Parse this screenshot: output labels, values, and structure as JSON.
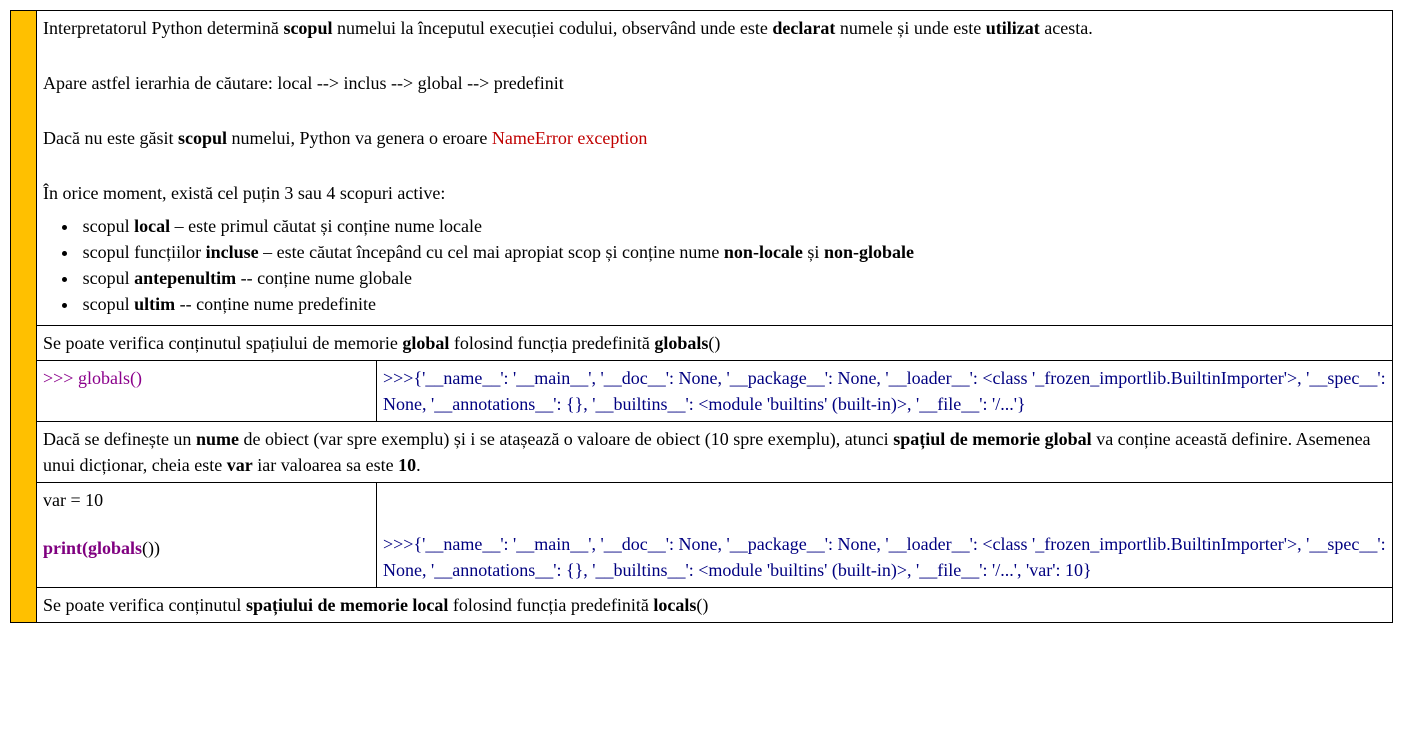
{
  "row1": {
    "p1": {
      "a": "Interpretatorul Python determină ",
      "b1": "scopul",
      "b": " numelui la începutul execuției codului, observând unde este ",
      "b2": "declarat",
      "c": " numele și unde este ",
      "b3": "utilizat",
      "d": " acesta."
    },
    "p2": "Apare astfel ierarhia de căutare: local --> inclus --> global --> predefinit",
    "p3": {
      "a": "Dacă nu este găsit ",
      "b1": "scopul",
      "b": " numelui, Python va genera o eroare ",
      "err": "NameError exception"
    },
    "p4": "În orice moment, există cel puțin 3 sau 4 scopuri active:",
    "li1": {
      "a": "scopul ",
      "b1": "local",
      "b": " – este primul căutat și conține nume locale"
    },
    "li2": {
      "a": "scopul funcțiilor ",
      "b1": "incluse",
      "b": " – este căutat începând cu cel mai apropiat scop și conține nume ",
      "b2": "non-locale",
      "c": " și ",
      "b3": "non-globale"
    },
    "li3": {
      "a": "scopul ",
      "b1": "antepenultim",
      "b": " -- conține nume globale"
    },
    "li4": {
      "a": "scopul ",
      "b1": "ultim",
      "b": " -- conține nume predefinite"
    }
  },
  "row2": {
    "a": "Se poate verifica conținutul spațiului de memorie ",
    "b1": "global",
    "b": " folosind funcția predefinită ",
    "b2": "globals",
    "c": "()"
  },
  "row3": {
    "left": {
      "prompt": ">>> ",
      "call": "globals()"
    },
    "right": ">>>{'__name__': '__main__', '__doc__': None, '__package__': None, '__loader__': <class '_frozen_importlib.BuiltinImporter'>, '__spec__': None, '__annotations__': {}, '__builtins__': <module 'builtins' (built-in)>, '__file__': '/...'}"
  },
  "row4": {
    "a": "Dacă se definește un ",
    "b1": "nume",
    "b": " de obiect (var spre exemplu) și i se atașează o valoare de obiect (10 spre exemplu), atunci ",
    "b2": "spațiul de memorie global",
    "c": " va conține această definire. Asemenea unui dicționar, cheia este ",
    "b3": "var",
    "d": " iar valoarea sa este ",
    "b4": "10",
    "e": "."
  },
  "row5": {
    "left": {
      "assign": "var = 10",
      "kw": "print(",
      "fn": "globals",
      "tail": "())"
    },
    "right": ">>>{'__name__': '__main__', '__doc__': None, '__package__': None, '__loader__': <class '_frozen_importlib.BuiltinImporter'>, '__spec__': None, '__annotations__': {}, '__builtins__': <module 'builtins' (built-in)>, '__file__': '/...', 'var': 10}"
  },
  "row6": {
    "a": "Se poate verifica conținutul ",
    "b1": "spațiului de memorie local",
    "b": " folosind funcția predefinită ",
    "b2": "locals",
    "c": "()"
  }
}
